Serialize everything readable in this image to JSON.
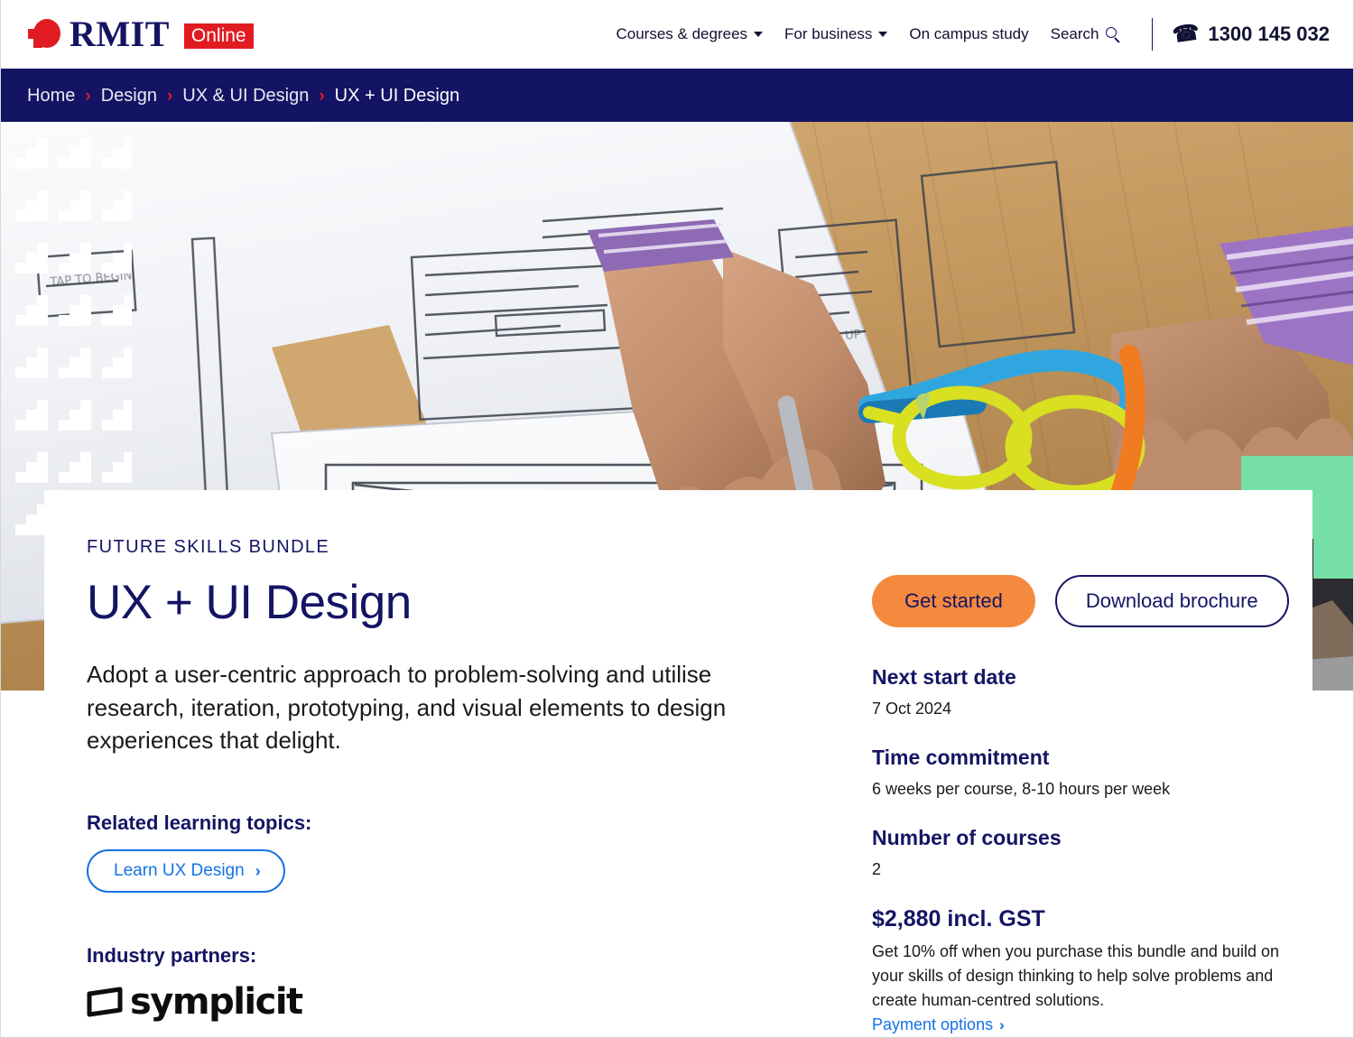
{
  "brand": {
    "name": "RMIT",
    "badge": "Online"
  },
  "header": {
    "nav": [
      {
        "label": "Courses & degrees",
        "icon": "chevron-down-icon",
        "has_caret": true
      },
      {
        "label": "For business",
        "icon": "chevron-down-icon",
        "has_caret": true
      },
      {
        "label": "On campus study",
        "has_caret": false
      },
      {
        "label": "Search",
        "icon": "search-icon",
        "has_caret": false
      }
    ],
    "phone": {
      "icon": "phone-icon",
      "number": "1300 145 032"
    }
  },
  "breadcrumb": {
    "separator": "›",
    "items": [
      {
        "label": "Home"
      },
      {
        "label": "Design"
      },
      {
        "label": "UX & UI Design"
      },
      {
        "label": "UX + UI Design",
        "current": true
      }
    ]
  },
  "hero": {
    "alt": "Hands arranging hand-drawn UI wireframe sketches on a wooden desk with yellow glasses",
    "decor_green": "#76DFA8"
  },
  "main": {
    "eyebrow": "FUTURE SKILLS BUNDLE",
    "title": "UX + UI Design",
    "description": "Adopt a user-centric approach to problem-solving and utilise research, iteration, prototyping, and visual elements to design experiences that delight.",
    "related_topics_label": "Related learning topics:",
    "related_topics": [
      {
        "label": "Learn UX Design",
        "icon": "chevron-right-icon"
      }
    ],
    "partners_label": "Industry partners:",
    "partners": [
      {
        "name": "symplicit",
        "icon": "symplicit-logo-icon"
      }
    ]
  },
  "sidebar": {
    "cta": {
      "primary": "Get started",
      "secondary": "Download brochure"
    },
    "facts": [
      {
        "heading": "Next start date",
        "value": "7 Oct 2024"
      },
      {
        "heading": "Time commitment",
        "value": "6 weeks per course, 8-10 hours per week"
      },
      {
        "heading": "Number of courses",
        "value": "2"
      }
    ],
    "price": {
      "heading": "$2,880 incl. GST",
      "body": "Get 10% off when you purchase this bundle and build on your skills of design thinking to help solve problems and create human-centred solutions.",
      "link": "Payment options",
      "link_icon": "chevron-right-icon"
    }
  },
  "colors": {
    "navy": "#141464",
    "red": "#E11B22",
    "orange": "#F58A3E",
    "blue": "#1473E6",
    "green": "#76DFA8"
  }
}
